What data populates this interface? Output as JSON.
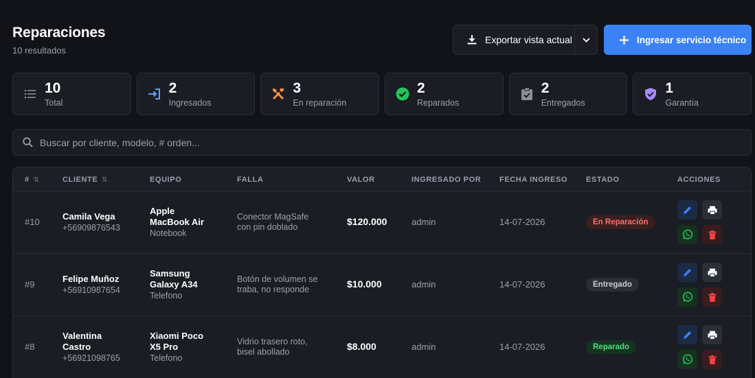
{
  "page": {
    "title": "Reparaciones",
    "result_count": "10 resultados"
  },
  "toolbar": {
    "export_label": "Exportar vista actual",
    "new_service_label": "Ingresar servicio técnico"
  },
  "stats": [
    {
      "value": "10",
      "label": "Total",
      "icon": "list-icon",
      "color": "#9aa1ad"
    },
    {
      "value": "2",
      "label": "Ingresados",
      "icon": "login-icon",
      "color": "#60a5fa"
    },
    {
      "value": "3",
      "label": "En reparación",
      "icon": "tools-icon",
      "color": "#fb923c"
    },
    {
      "value": "2",
      "label": "Reparados",
      "icon": "check-circle-icon",
      "color": "#22c55e"
    },
    {
      "value": "2",
      "label": "Entregados",
      "icon": "clipboard-check-icon",
      "color": "#9aa1ad"
    },
    {
      "value": "1",
      "label": "Garantía",
      "icon": "shield-check-icon",
      "color": "#a78bfa"
    }
  ],
  "search": {
    "placeholder": "Buscar por cliente, modelo, # orden..."
  },
  "table": {
    "columns": [
      "#",
      "CLIENTE",
      "EQUIPO",
      "FALLA",
      "VALOR",
      "INGRESADO POR",
      "FECHA INGRESO",
      "ESTADO",
      "ACCIONES"
    ],
    "rows": [
      {
        "id": "#10",
        "client_name_lines": [
          "Camila Vega"
        ],
        "client_phone": "+56909876543",
        "equipment_lines": [
          "Apple",
          "MacBook Air"
        ],
        "equipment_type": "Notebook",
        "fault_lines": [
          "Conector MagSafe",
          "con pin doblado"
        ],
        "value": "$120.000",
        "user": "admin",
        "date": "14-07-2026",
        "status": "En Reparación",
        "status_color": "#f87171",
        "status_bg": "#3b1f1f"
      },
      {
        "id": "#9",
        "client_name_lines": [
          "Felipe Muñoz"
        ],
        "client_phone": "+56910987654",
        "equipment_lines": [
          "Samsung",
          "Galaxy A34"
        ],
        "equipment_type": "Telefono",
        "fault_lines": [
          "Botón de volumen se",
          "traba, no responde"
        ],
        "value": "$10.000",
        "user": "admin",
        "date": "14-07-2026",
        "status": "Entregado",
        "status_color": "#c7cbd3",
        "status_bg": "#2a2e36"
      },
      {
        "id": "#8",
        "client_name_lines": [
          "Valentina",
          "Castro"
        ],
        "client_phone": "+56921098765",
        "equipment_lines": [
          "Xiaomi Poco",
          "X5 Pro"
        ],
        "equipment_type": "Telefono",
        "fault_lines": [
          "Vidrio trasero roto,",
          "bisel abollado"
        ],
        "value": "$8.000",
        "user": "admin",
        "date": "14-07-2026",
        "status": "Reparado",
        "status_color": "#4ade80",
        "status_bg": "#16331f"
      }
    ]
  },
  "colors": {
    "accent": "#3b82f6",
    "background": "#111318",
    "card": "#1a1d23"
  }
}
